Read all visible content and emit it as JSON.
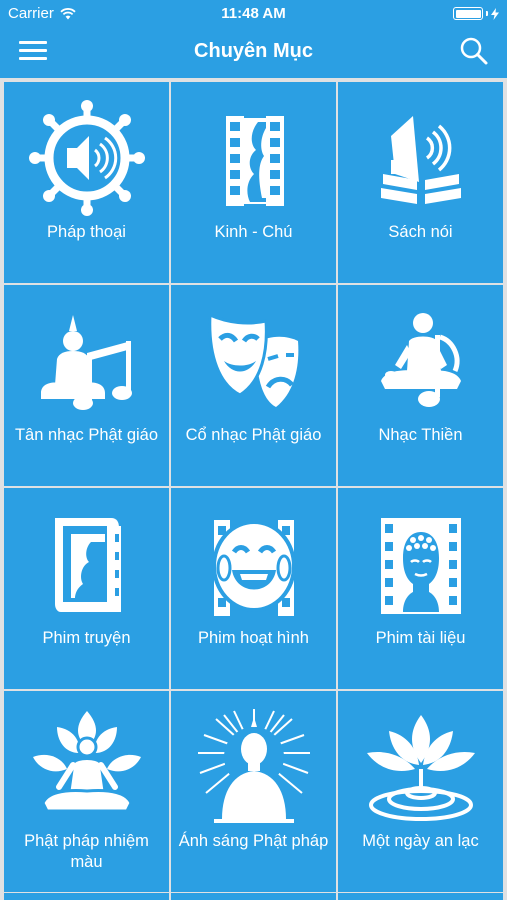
{
  "status_bar": {
    "carrier": "Carrier",
    "time": "11:48 AM",
    "battery_level": 1.0,
    "wifi_icon": "wifi-icon",
    "battery_icon": "battery-icon",
    "charging_icon": "bolt-icon"
  },
  "nav": {
    "title": "Chuyên Mục",
    "menu_icon": "hamburger-icon",
    "search_icon": "search-icon",
    "background_color": "#2b9fe3"
  },
  "categories": [
    {
      "label": "Pháp thoại",
      "icon": "dharma-wheel-speaker-icon"
    },
    {
      "label": "Kinh - Chú",
      "icon": "film-buddha-icon"
    },
    {
      "label": "Sách nói",
      "icon": "audiobook-icon"
    },
    {
      "label": "Tân nhạc Phật giáo",
      "icon": "buddha-music-note-icon"
    },
    {
      "label": "Cổ nhạc Phật giáo",
      "icon": "theater-masks-icon"
    },
    {
      "label": "Nhạc Thiền",
      "icon": "meditation-music-icon"
    },
    {
      "label": "Phim truyện",
      "icon": "film-book-icon"
    },
    {
      "label": "Phim hoạt hình",
      "icon": "laughing-buddha-film-icon"
    },
    {
      "label": "Phim tài liệu",
      "icon": "buddha-head-film-icon"
    },
    {
      "label": "Phật pháp nhiệm màu",
      "icon": "lotus-meditation-icon"
    },
    {
      "label": "Ánh sáng Phật pháp",
      "icon": "radiant-buddha-icon"
    },
    {
      "label": "Một ngày an lạc",
      "icon": "lotus-water-icon"
    }
  ],
  "colors": {
    "tile": "#2b9fe3",
    "divider": "#dfe1e3",
    "text": "#ffffff"
  }
}
